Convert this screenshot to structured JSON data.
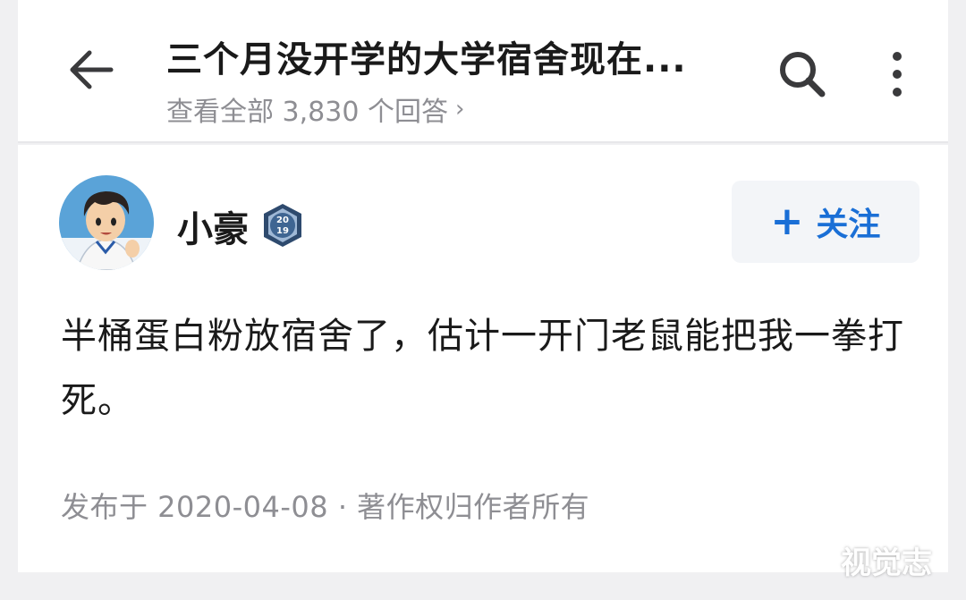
{
  "header": {
    "title": "三个月没开学的大学宿舍现在...",
    "subtitle": "查看全部 3,830 个回答",
    "subtitle_chevron": "›"
  },
  "answer": {
    "author_name": "小豪",
    "badge_text_top": "20",
    "badge_text_bottom": "19",
    "follow_label": "关注",
    "follow_plus": "+",
    "content": "半桶蛋白粉放宿舍了，估计一开门老鼠能把我一拳打死。",
    "meta": "发布于 2020-04-08 · 著作权归作者所有"
  },
  "watermark": "视觉志",
  "icons": {
    "back": "arrow-left-icon",
    "search": "search-icon",
    "more": "more-vertical-icon",
    "badge": "anniversary-badge-icon"
  },
  "colors": {
    "accent": "#1a6fd6",
    "text": "#1a1a1a",
    "secondary": "#8e8e93",
    "follow_bg": "#f3f5f8",
    "page_bg": "#f0f0f2"
  }
}
